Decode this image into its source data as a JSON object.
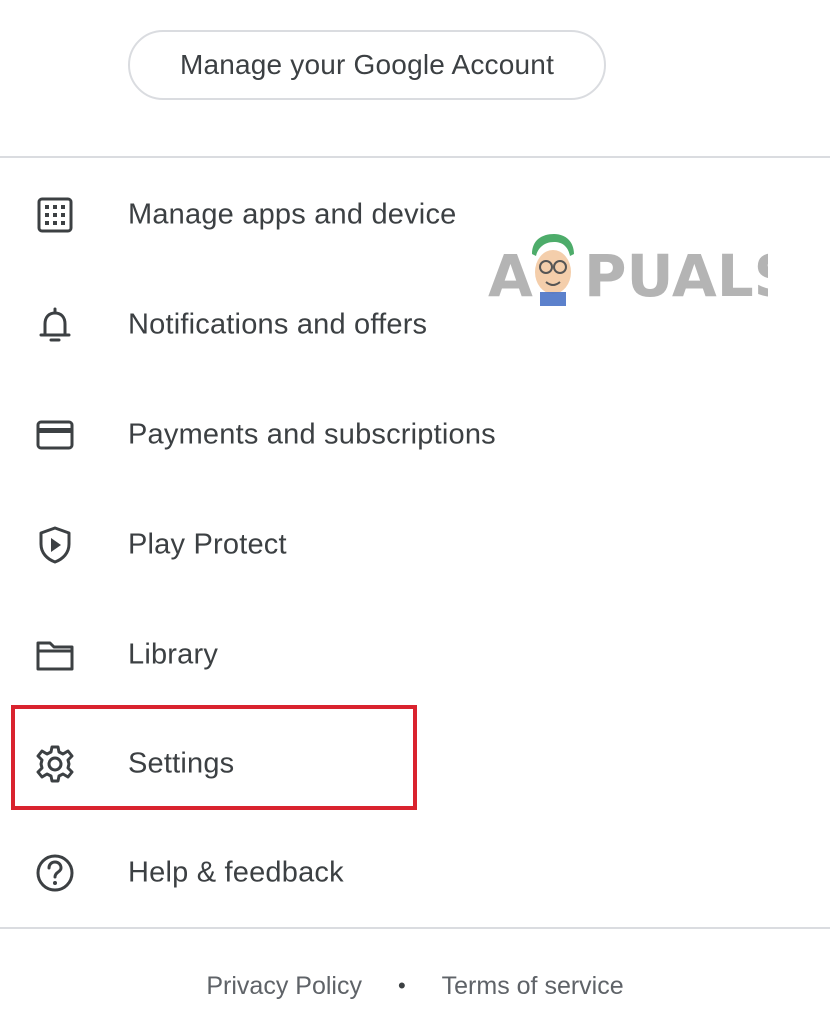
{
  "account": {
    "manage_label": "Manage your Google Account"
  },
  "menu": {
    "items": [
      {
        "id": "manage-apps",
        "label": "Manage apps and device",
        "icon": "apps-grid-icon"
      },
      {
        "id": "notifications",
        "label": "Notifications and offers",
        "icon": "bell-icon"
      },
      {
        "id": "payments",
        "label": "Payments and subscriptions",
        "icon": "credit-card-icon"
      },
      {
        "id": "play-protect",
        "label": "Play Protect",
        "icon": "shield-play-icon"
      },
      {
        "id": "library",
        "label": "Library",
        "icon": "folder-icon"
      },
      {
        "id": "settings",
        "label": "Settings",
        "icon": "gear-icon",
        "highlighted": true
      },
      {
        "id": "help",
        "label": "Help & feedback",
        "icon": "help-circle-icon"
      }
    ]
  },
  "footer": {
    "privacy_label": "Privacy Policy",
    "separator": "•",
    "terms_label": "Terms of service"
  },
  "watermark": {
    "text": "APPUALS"
  },
  "colors": {
    "text": "#3c4043",
    "divider": "#dadce0",
    "highlight": "#d9232e",
    "footer_text": "#5f6368"
  }
}
